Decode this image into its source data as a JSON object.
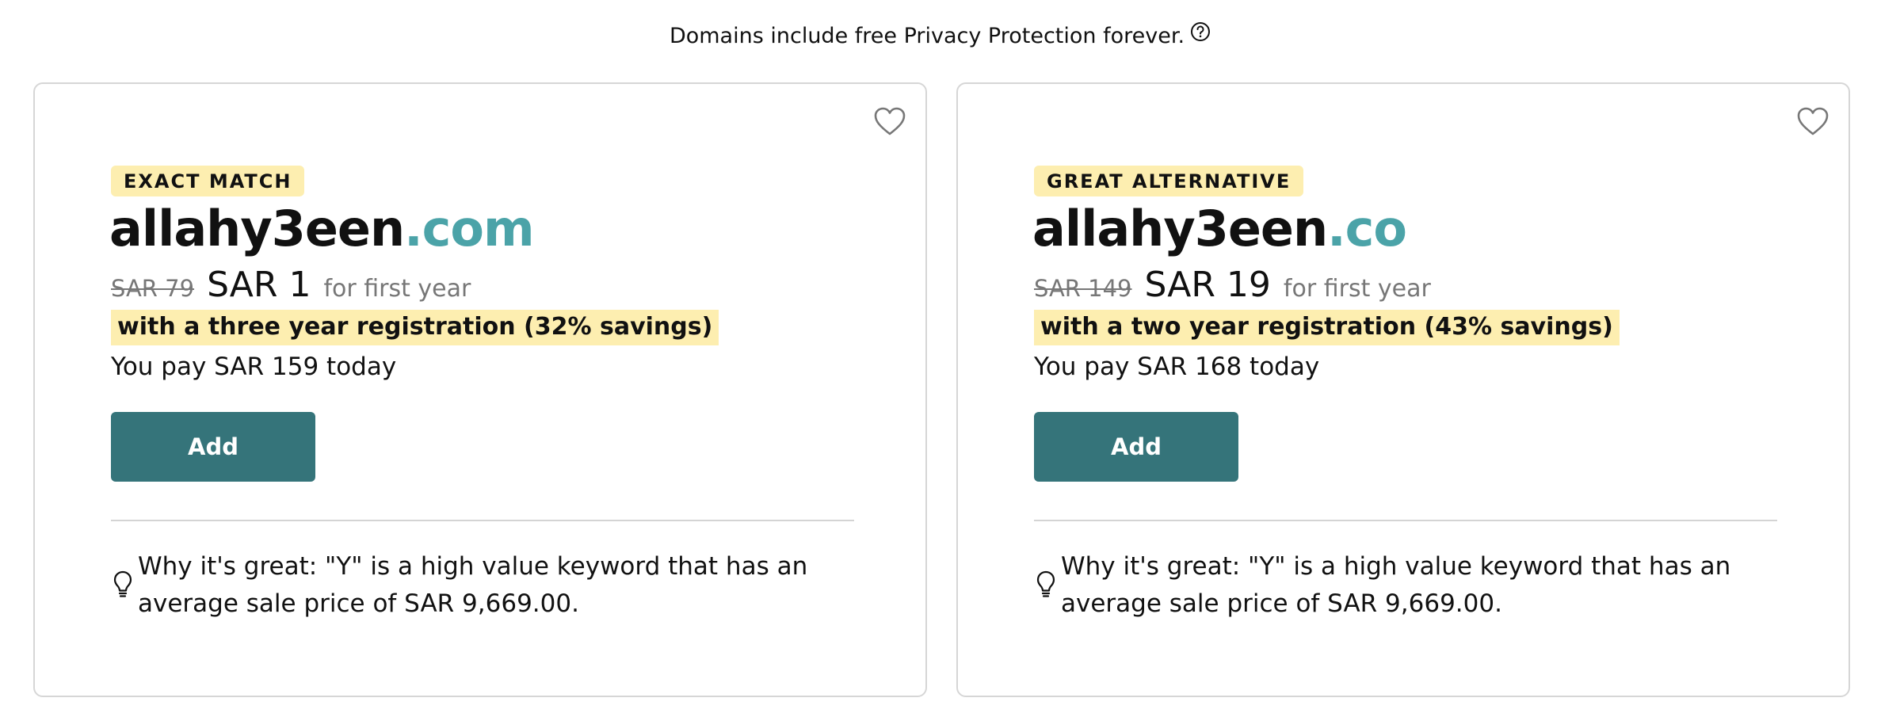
{
  "notice": {
    "text": "Domains include free Privacy Protection forever.",
    "icon": "question-circle-icon"
  },
  "cards": [
    {
      "badge": "EXACT MATCH",
      "domain_name": "allahy3een",
      "tld": ".com",
      "old_price": "SAR 79",
      "new_price": "SAR 1",
      "term": "for first year",
      "savings": "with a three year registration (32% savings)",
      "pay_today": "You pay SAR 159 today",
      "add_label": "Add",
      "reason": "Why it's great: \"Y\" is a high value keyword that has an average sale price of SAR 9,669.00.",
      "favorite_icon": "heart-icon",
      "reason_icon": "lightbulb-icon"
    },
    {
      "badge": "GREAT ALTERNATIVE",
      "domain_name": "allahy3een",
      "tld": ".co",
      "old_price": "SAR 149",
      "new_price": "SAR 19",
      "term": "for first year",
      "savings": "with a two year registration (43% savings)",
      "pay_today": "You pay SAR 168 today",
      "add_label": "Add",
      "reason": "Why it's great: \"Y\" is a high value keyword that has an average sale price of SAR 9,669.00.",
      "favorite_icon": "heart-icon",
      "reason_icon": "lightbulb-icon"
    }
  ],
  "colors": {
    "accent_button": "#35747a",
    "tld": "#4ba3a8",
    "highlight": "#fdeeb0",
    "border": "#d6d6d6"
  }
}
